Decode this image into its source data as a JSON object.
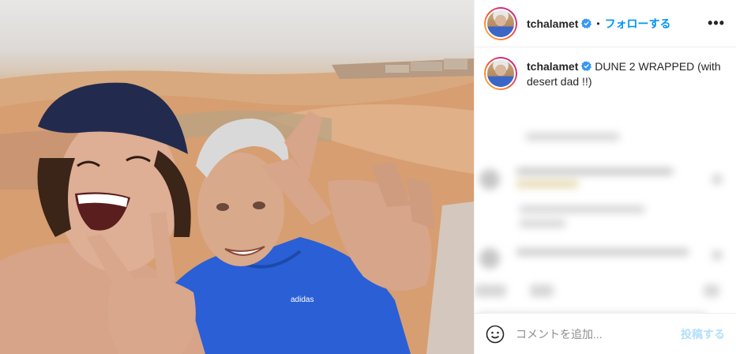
{
  "photo": {
    "description_icon": "photo",
    "shirt_brand": "adidas"
  },
  "header": {
    "username": "tchalamet",
    "separator": "•",
    "follow_label": "フォローする",
    "more_icon": "more-horizontal-icon",
    "more_label": "•••"
  },
  "caption": {
    "username": "tchalamet",
    "text": "DUNE 2 WRAPPED (with desert dad !!)"
  },
  "comment_box": {
    "placeholder": "コメントを追加...",
    "post_label": "投稿する"
  },
  "colors": {
    "accent": "#0095f6",
    "post_disabled": "#b2dffc",
    "verified": "#3897f0"
  }
}
